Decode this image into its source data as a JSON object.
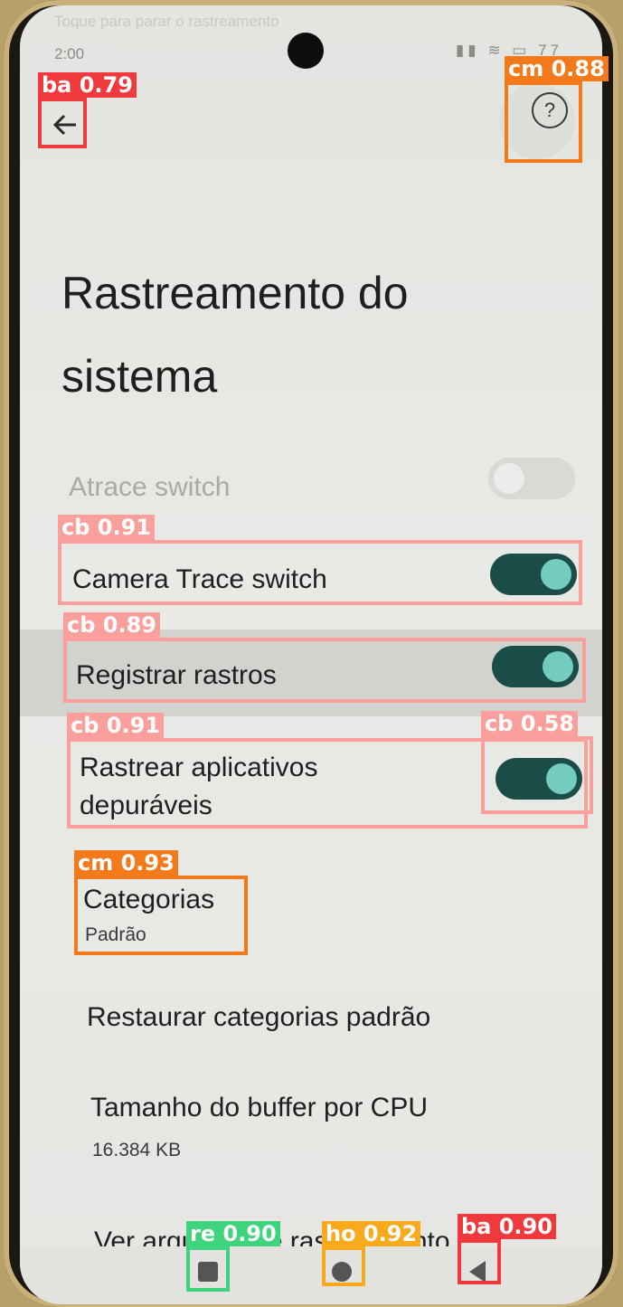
{
  "status_bar": {
    "time": "2:00",
    "ghost_text": "Toque para parar o rastreamento",
    "status_icons": "▮▮  ≋  ▭  77",
    "notification_icons": "◎ ✉ ▣"
  },
  "header": {
    "back_icon": "arrow-left-icon",
    "help_icon": "help-circle-icon",
    "back_glyph": "←",
    "help_glyph": "?"
  },
  "page": {
    "title": "Rastreamento do sistema"
  },
  "settings": {
    "atrace_switch": {
      "label": "Atrace switch",
      "checked": false,
      "enabled": false
    },
    "camera_trace_switch": {
      "label": "Camera Trace switch",
      "checked": true
    },
    "record_traces": {
      "label": "Registrar rastros",
      "checked": true
    },
    "trace_debuggable_apps": {
      "label": "Rastrear aplicativos depuráveis",
      "label_line1": "Rastrear aplicativos",
      "label_line2": "depuráveis",
      "checked": true
    },
    "categories": {
      "label": "Categorias",
      "value": "Padrão"
    },
    "restore_categories": {
      "label": "Restaurar categorias padrão"
    },
    "buffer_size": {
      "label": "Tamanho do buffer por CPU",
      "value": "16.384 KB"
    },
    "view_saved": {
      "label": "Ver arquivos de rastreamento"
    }
  },
  "nav_bar": {
    "recents_icon": "square-recents-icon",
    "home_icon": "circle-home-icon",
    "back_icon": "triangle-back-icon"
  },
  "detections": [
    {
      "tag": "ba 0.79",
      "color": "#f0393c"
    },
    {
      "tag": "cm 0.88",
      "color": "#f27a1a"
    },
    {
      "tag": "cb 0.91",
      "color": "#fb9f9c"
    },
    {
      "tag": "cb 0.89",
      "color": "#fb9f9c"
    },
    {
      "tag": "cb 0.91",
      "color": "#fb9f9c"
    },
    {
      "tag": "cb 0.58",
      "color": "#fb9f9c"
    },
    {
      "tag": "cm 0.93",
      "color": "#f27a1a"
    },
    {
      "tag": "re 0.90",
      "color": "#3ed47e"
    },
    {
      "tag": "ho 0.92",
      "color": "#f8aa1c"
    },
    {
      "tag": "ba 0.90",
      "color": "#f0393c"
    }
  ]
}
